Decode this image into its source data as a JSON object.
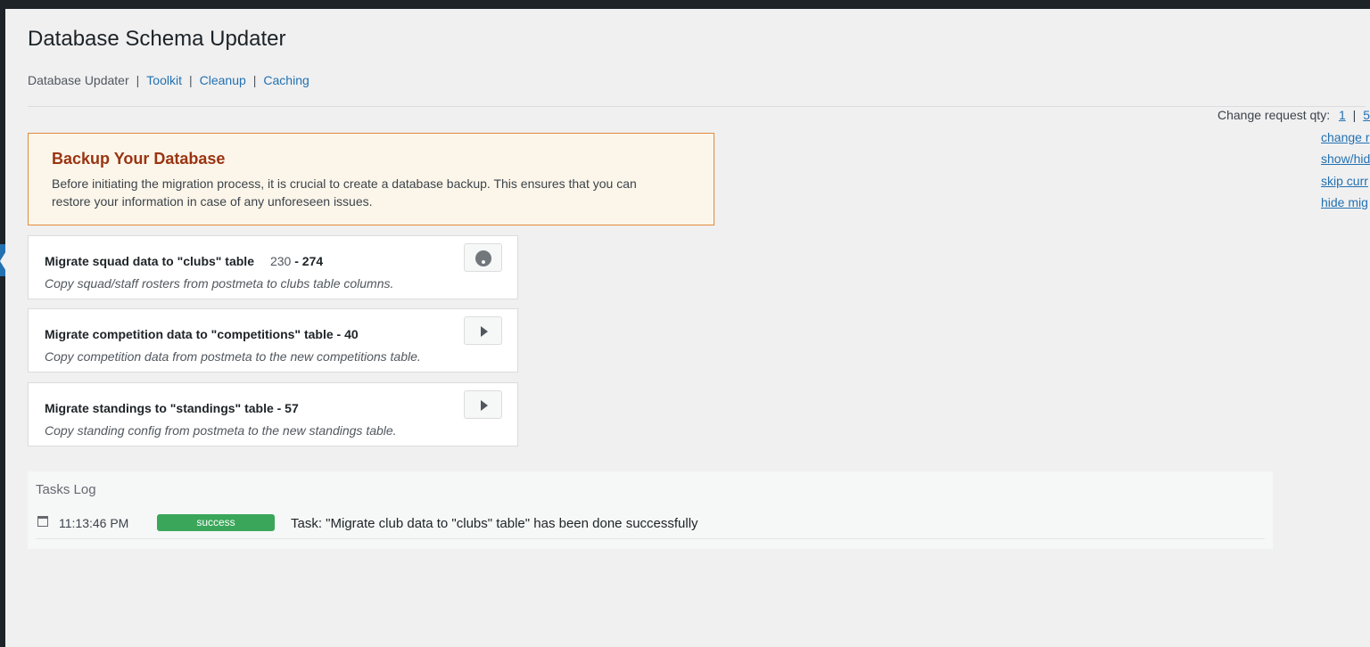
{
  "page": {
    "title": "Database Schema Updater"
  },
  "subnav": {
    "current": "Database Updater",
    "links": [
      "Toolkit",
      "Cleanup",
      "Caching"
    ],
    "separator": "|"
  },
  "right_panel": {
    "qty_label": "Change request qty:",
    "qty_options": [
      "1",
      "5"
    ],
    "qty_separator": "|",
    "links": [
      "change r",
      "show/hid",
      "skip curr",
      "hide mig"
    ]
  },
  "notice": {
    "title": "Backup Your Database",
    "text": "Before initiating the migration process, it is crucial to create a database backup. This ensures that you can restore your information in case of any unforeseen issues."
  },
  "tasks": [
    {
      "title": "Migrate squad data to \"clubs\" table",
      "range_from": "230",
      "range_to": "- 274",
      "description": "Copy squad/staff rosters from postmeta to clubs table columns.",
      "state": "running"
    },
    {
      "title": "Migrate competition data to \"competitions\" table - 40",
      "description": "Copy competition data from postmeta to the new competitions table.",
      "state": "idle"
    },
    {
      "title": "Migrate standings to \"standings\" table - 57",
      "description": "Copy standing config from postmeta to the new standings table.",
      "state": "idle"
    }
  ],
  "log": {
    "title": "Tasks Log",
    "entries": [
      {
        "time": "11:13:46 PM",
        "status": "success",
        "message": "Task: \"Migrate club data to \"clubs\" table\" has been done successfully"
      }
    ]
  },
  "colors": {
    "link": "#2271b1",
    "notice_border": "#e08a3c",
    "notice_title": "#9a3412",
    "success": "#3aa65a"
  }
}
